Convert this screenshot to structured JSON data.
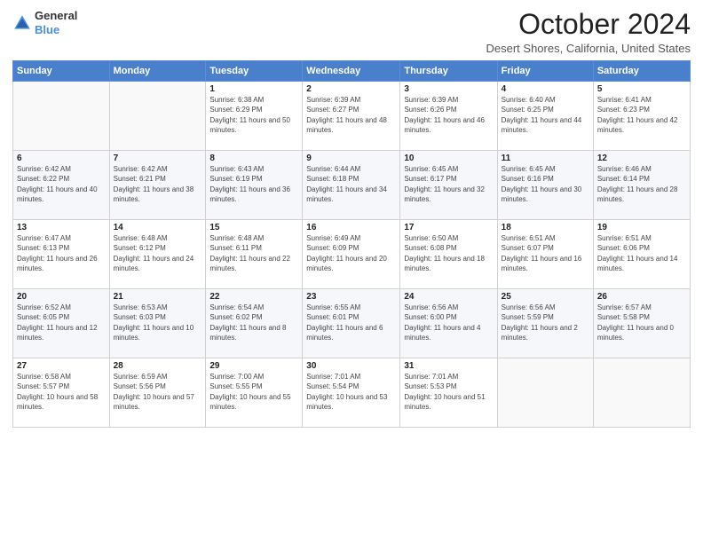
{
  "header": {
    "logo": {
      "general": "General",
      "blue": "Blue"
    },
    "title": "October 2024",
    "location": "Desert Shores, California, United States"
  },
  "weekdays": [
    "Sunday",
    "Monday",
    "Tuesday",
    "Wednesday",
    "Thursday",
    "Friday",
    "Saturday"
  ],
  "weeks": [
    [
      {
        "day": "",
        "info": ""
      },
      {
        "day": "",
        "info": ""
      },
      {
        "day": "1",
        "info": "Sunrise: 6:38 AM\nSunset: 6:29 PM\nDaylight: 11 hours and 50 minutes."
      },
      {
        "day": "2",
        "info": "Sunrise: 6:39 AM\nSunset: 6:27 PM\nDaylight: 11 hours and 48 minutes."
      },
      {
        "day": "3",
        "info": "Sunrise: 6:39 AM\nSunset: 6:26 PM\nDaylight: 11 hours and 46 minutes."
      },
      {
        "day": "4",
        "info": "Sunrise: 6:40 AM\nSunset: 6:25 PM\nDaylight: 11 hours and 44 minutes."
      },
      {
        "day": "5",
        "info": "Sunrise: 6:41 AM\nSunset: 6:23 PM\nDaylight: 11 hours and 42 minutes."
      }
    ],
    [
      {
        "day": "6",
        "info": "Sunrise: 6:42 AM\nSunset: 6:22 PM\nDaylight: 11 hours and 40 minutes."
      },
      {
        "day": "7",
        "info": "Sunrise: 6:42 AM\nSunset: 6:21 PM\nDaylight: 11 hours and 38 minutes."
      },
      {
        "day": "8",
        "info": "Sunrise: 6:43 AM\nSunset: 6:19 PM\nDaylight: 11 hours and 36 minutes."
      },
      {
        "day": "9",
        "info": "Sunrise: 6:44 AM\nSunset: 6:18 PM\nDaylight: 11 hours and 34 minutes."
      },
      {
        "day": "10",
        "info": "Sunrise: 6:45 AM\nSunset: 6:17 PM\nDaylight: 11 hours and 32 minutes."
      },
      {
        "day": "11",
        "info": "Sunrise: 6:45 AM\nSunset: 6:16 PM\nDaylight: 11 hours and 30 minutes."
      },
      {
        "day": "12",
        "info": "Sunrise: 6:46 AM\nSunset: 6:14 PM\nDaylight: 11 hours and 28 minutes."
      }
    ],
    [
      {
        "day": "13",
        "info": "Sunrise: 6:47 AM\nSunset: 6:13 PM\nDaylight: 11 hours and 26 minutes."
      },
      {
        "day": "14",
        "info": "Sunrise: 6:48 AM\nSunset: 6:12 PM\nDaylight: 11 hours and 24 minutes."
      },
      {
        "day": "15",
        "info": "Sunrise: 6:48 AM\nSunset: 6:11 PM\nDaylight: 11 hours and 22 minutes."
      },
      {
        "day": "16",
        "info": "Sunrise: 6:49 AM\nSunset: 6:09 PM\nDaylight: 11 hours and 20 minutes."
      },
      {
        "day": "17",
        "info": "Sunrise: 6:50 AM\nSunset: 6:08 PM\nDaylight: 11 hours and 18 minutes."
      },
      {
        "day": "18",
        "info": "Sunrise: 6:51 AM\nSunset: 6:07 PM\nDaylight: 11 hours and 16 minutes."
      },
      {
        "day": "19",
        "info": "Sunrise: 6:51 AM\nSunset: 6:06 PM\nDaylight: 11 hours and 14 minutes."
      }
    ],
    [
      {
        "day": "20",
        "info": "Sunrise: 6:52 AM\nSunset: 6:05 PM\nDaylight: 11 hours and 12 minutes."
      },
      {
        "day": "21",
        "info": "Sunrise: 6:53 AM\nSunset: 6:03 PM\nDaylight: 11 hours and 10 minutes."
      },
      {
        "day": "22",
        "info": "Sunrise: 6:54 AM\nSunset: 6:02 PM\nDaylight: 11 hours and 8 minutes."
      },
      {
        "day": "23",
        "info": "Sunrise: 6:55 AM\nSunset: 6:01 PM\nDaylight: 11 hours and 6 minutes."
      },
      {
        "day": "24",
        "info": "Sunrise: 6:56 AM\nSunset: 6:00 PM\nDaylight: 11 hours and 4 minutes."
      },
      {
        "day": "25",
        "info": "Sunrise: 6:56 AM\nSunset: 5:59 PM\nDaylight: 11 hours and 2 minutes."
      },
      {
        "day": "26",
        "info": "Sunrise: 6:57 AM\nSunset: 5:58 PM\nDaylight: 11 hours and 0 minutes."
      }
    ],
    [
      {
        "day": "27",
        "info": "Sunrise: 6:58 AM\nSunset: 5:57 PM\nDaylight: 10 hours and 58 minutes."
      },
      {
        "day": "28",
        "info": "Sunrise: 6:59 AM\nSunset: 5:56 PM\nDaylight: 10 hours and 57 minutes."
      },
      {
        "day": "29",
        "info": "Sunrise: 7:00 AM\nSunset: 5:55 PM\nDaylight: 10 hours and 55 minutes."
      },
      {
        "day": "30",
        "info": "Sunrise: 7:01 AM\nSunset: 5:54 PM\nDaylight: 10 hours and 53 minutes."
      },
      {
        "day": "31",
        "info": "Sunrise: 7:01 AM\nSunset: 5:53 PM\nDaylight: 10 hours and 51 minutes."
      },
      {
        "day": "",
        "info": ""
      },
      {
        "day": "",
        "info": ""
      }
    ]
  ]
}
